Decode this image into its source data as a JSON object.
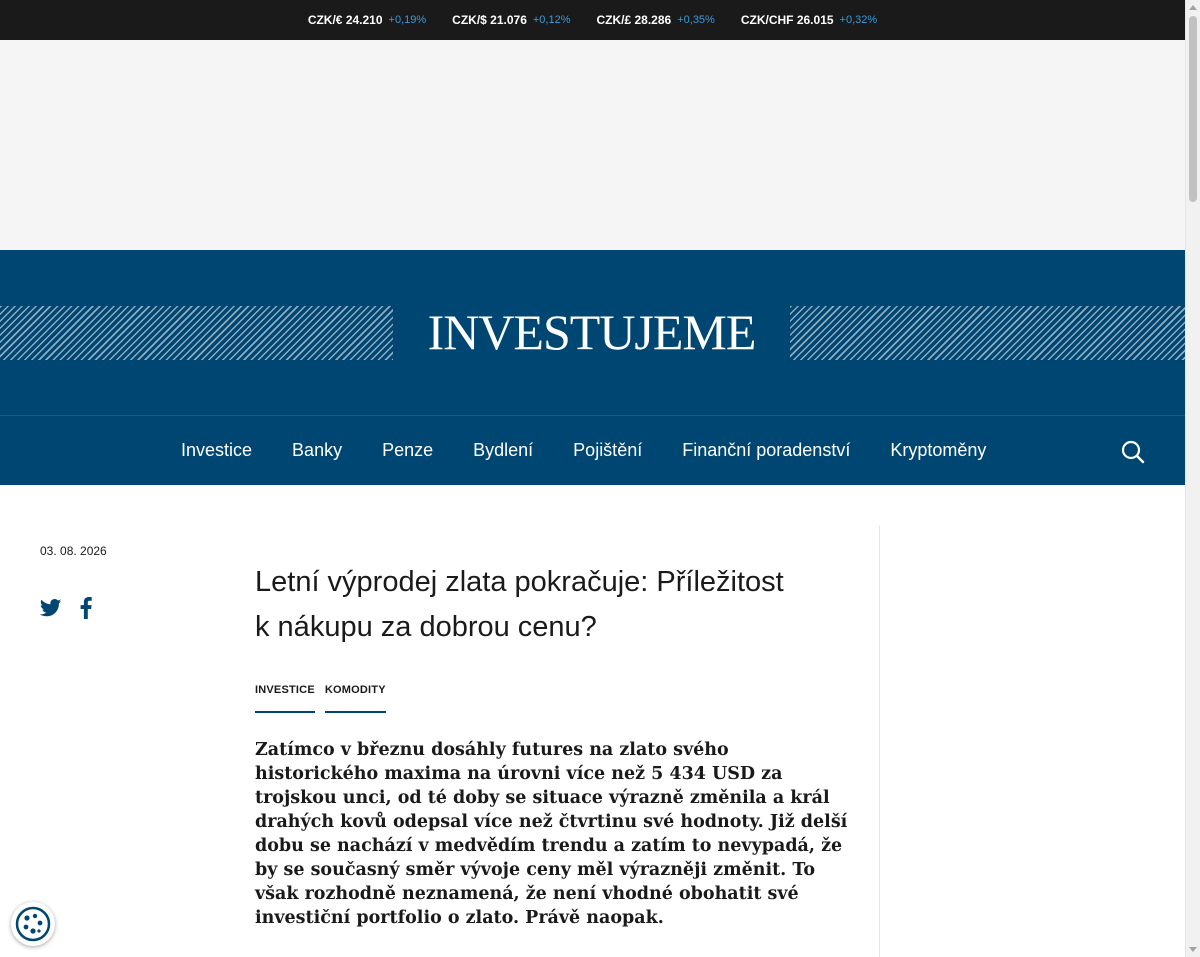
{
  "ticker": [
    {
      "pair": "CZK/€ 24.210",
      "change": "+0,19%"
    },
    {
      "pair": "CZK/$ 21.076",
      "change": "+0,12%"
    },
    {
      "pair": "CZK/£ 28.286",
      "change": "+0,35%"
    },
    {
      "pair": "CZK/CHF 26.015",
      "change": "+0,32%"
    }
  ],
  "header": {
    "logo": "INVESTUJEME"
  },
  "nav": {
    "items": [
      "Investice",
      "Banky",
      "Penze",
      "Bydlení",
      "Pojištění",
      "Finanční poradenství",
      "Kryptoměny"
    ],
    "search_icon": "search-icon"
  },
  "article": {
    "date": "03. 08. 2026",
    "title": "Letní výprodej zlata pokračuje: Příležitost k nákupu za dobrou cenu?",
    "tags": [
      "INVESTICE",
      "KOMODITY"
    ],
    "lead": "Zatímco v březnu dosáhly futures na zlato svého historického maxima na úrovni více než 5 434 USD za trojskou unci, od té doby se situace výrazně změnila a král drahých kovů odepsal více než čtvrtinu své hodnoty. Již delší dobu se nachází v medvědím trendu a zatím to nevypadá, že by se současný směr vývoje ceny měl výrazněji změnit. To však rozhodně neznamená, že není vhodné obohatit své investiční portfolio o zlato. Právě naopak."
  },
  "share": {
    "icons": [
      "twitter-icon",
      "facebook-icon"
    ]
  },
  "colors": {
    "brand": "#004672",
    "ticker_bg": "#1a1a1a",
    "change": "#3a9ad9"
  }
}
